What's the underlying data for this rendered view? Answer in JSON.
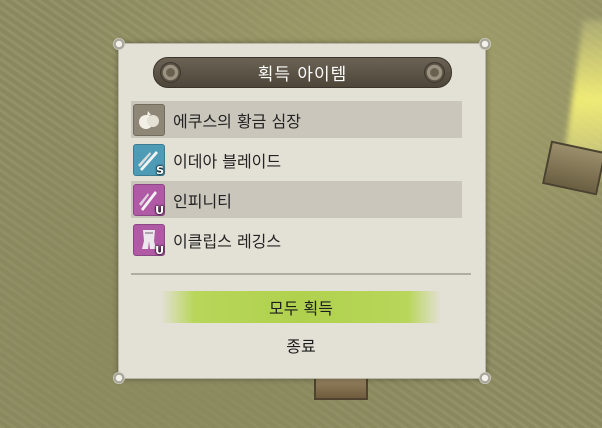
{
  "dialog": {
    "title": "획득 아이템",
    "items": [
      {
        "name": "에쿠스의 황금 심장",
        "icon": "golden-heart-pouch-icon",
        "grade": "",
        "color": "#8e8778"
      },
      {
        "name": "이데아 블레이드",
        "icon": "twin-blade-icon",
        "grade": "S",
        "color": "#4d9bb5"
      },
      {
        "name": "인피니티",
        "icon": "blade-weapon-icon",
        "grade": "U",
        "color": "#b05aa6"
      },
      {
        "name": "이클립스 레깅스",
        "icon": "leg-armor-icon",
        "grade": "U",
        "color": "#b05aa6"
      }
    ],
    "take_all_label": "모두 획득",
    "close_label": "종료"
  }
}
